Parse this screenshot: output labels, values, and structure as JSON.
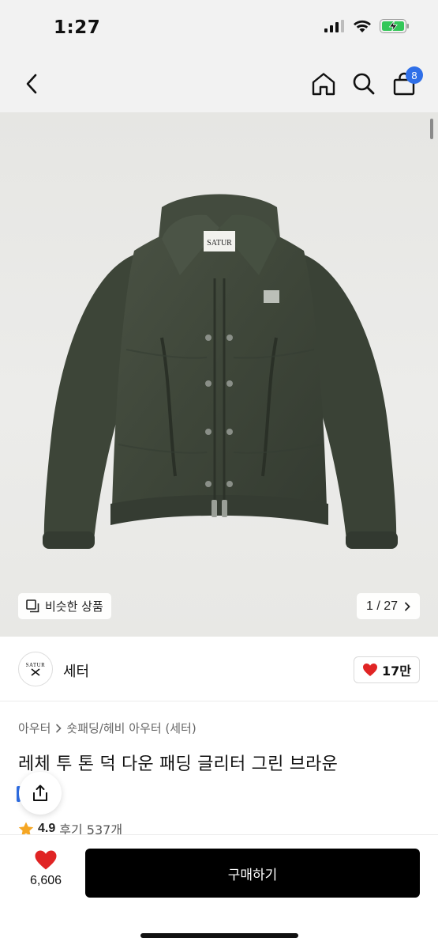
{
  "status_bar": {
    "time": "1:27"
  },
  "nav": {
    "cart_count": "8"
  },
  "hero": {
    "brand_label": "SATUR",
    "similar_label": "비슷한 상품",
    "pager_text": "1 / 27"
  },
  "seller": {
    "logo_text": "SATUR",
    "name": "세터",
    "likes": "17만"
  },
  "breadcrumb": {
    "items": [
      "아우터",
      "숏패딩/헤비 아우터 (세터)"
    ]
  },
  "product": {
    "title": "레체 투 톤 덕 다운 패딩 글리터 그린 브라운",
    "rating": "4.9",
    "reviews": "후기 537개"
  },
  "bottom_bar": {
    "wish_count": "6,606",
    "buy_label": "구매하기"
  },
  "colors": {
    "accent": "#2f6fe8",
    "heart": "#e02424",
    "star": "#f5a623",
    "jacket": "#3f463a"
  }
}
